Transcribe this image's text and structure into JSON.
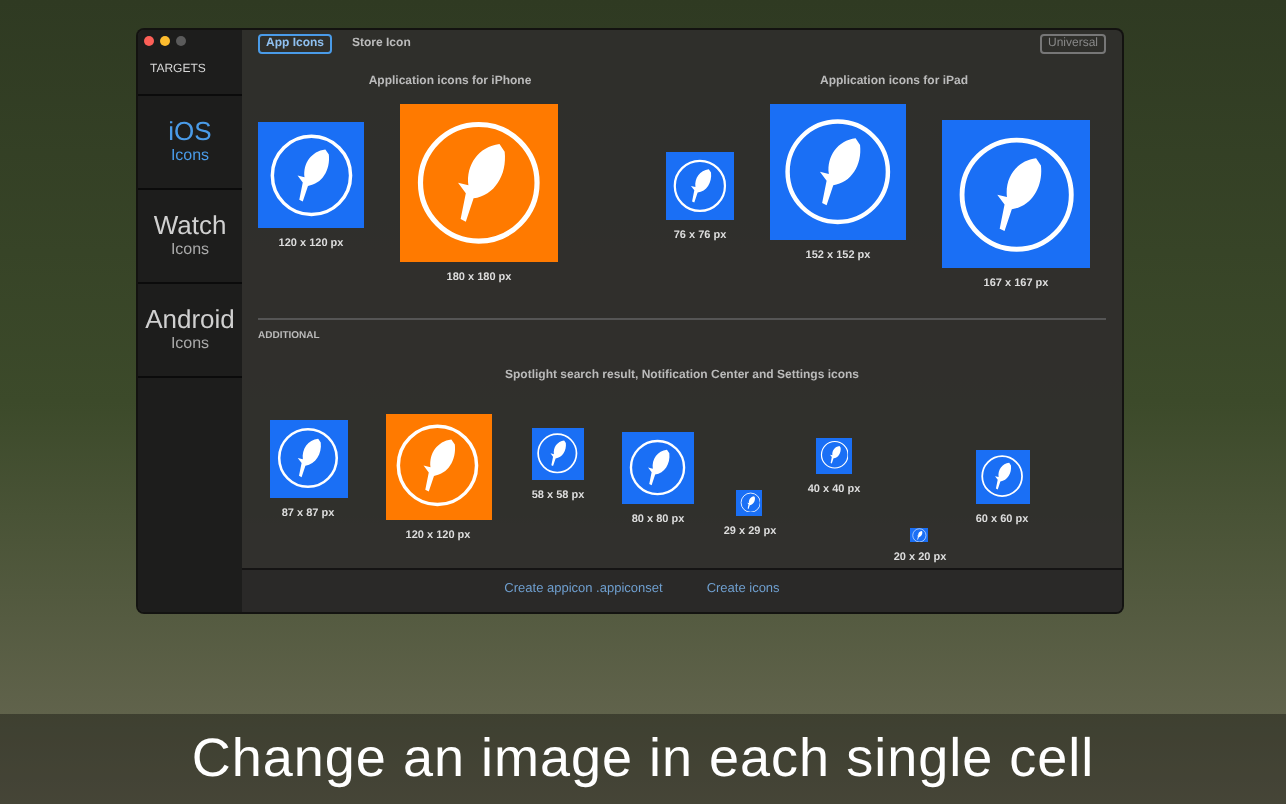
{
  "tabs": [
    {
      "label": "App Icons",
      "selected": true
    },
    {
      "label": "Store Icon",
      "selected": false
    }
  ],
  "device_popup": {
    "value": "Universal"
  },
  "sidebar": {
    "heading": "TARGETS",
    "items": [
      {
        "title": "iOS",
        "subtitle": "Icons",
        "selected": true
      },
      {
        "title": "Watch",
        "subtitle": "Icons",
        "selected": false
      },
      {
        "title": "Android",
        "subtitle": "Icons",
        "selected": false
      }
    ]
  },
  "sections": [
    {
      "title": "Application icons for iPhone",
      "icons": [
        {
          "label": "120 x 120 px",
          "color": "#1a6ff5"
        },
        {
          "label": "180 x 180 px",
          "color": "#ff7a00"
        }
      ]
    },
    {
      "title": "Application icons for iPad",
      "icons": [
        {
          "label": "76 x 76 px",
          "color": "#1a6ff5"
        },
        {
          "label": "152 x 152 px",
          "color": "#1a6ff5"
        },
        {
          "label": "167 x 167 px",
          "color": "#1a6ff5"
        }
      ]
    }
  ],
  "additional": {
    "heading": "ADDITIONAL",
    "title": "Spotlight search result, Notification Center and Settings icons",
    "icons": [
      {
        "label": "87 x 87 px",
        "color": "#1a6ff5"
      },
      {
        "label": "120 x 120 px",
        "color": "#ff7a00"
      },
      {
        "label": "58 x 58 px",
        "color": "#1a6ff5"
      },
      {
        "label": "80 x 80 px",
        "color": "#1a6ff5"
      },
      {
        "label": "29 x 29 px",
        "color": "#1a6ff5"
      },
      {
        "label": "40 x 40 px",
        "color": "#1a6ff5"
      },
      {
        "label": "20 x 20 px",
        "color": "#1a6ff5"
      },
      {
        "label": "60 x 60 px",
        "color": "#1a6ff5"
      }
    ]
  },
  "footer_links": [
    "Create appicon .appiconset",
    "Create icons"
  ],
  "caption": "Change an image in each single cell"
}
